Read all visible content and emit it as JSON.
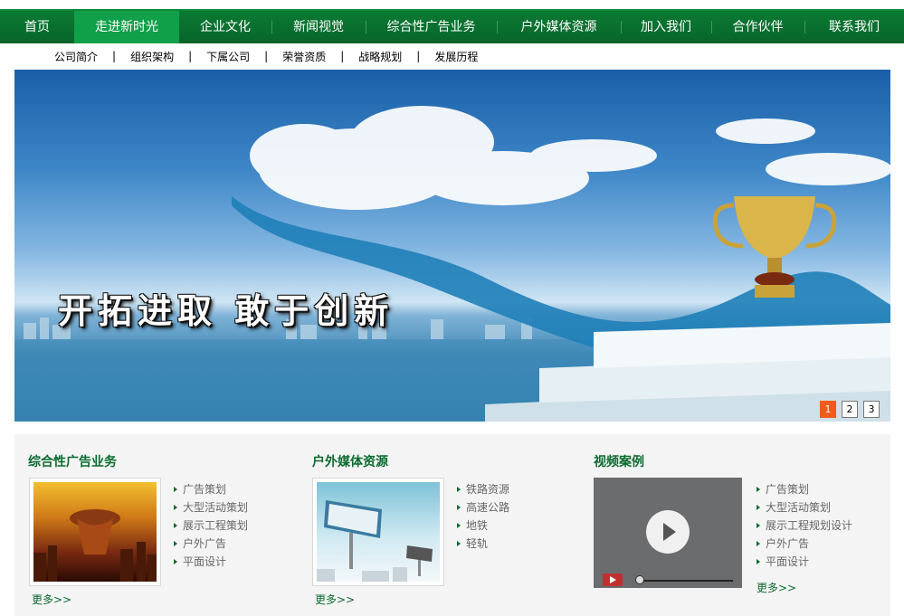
{
  "nav": {
    "items": [
      {
        "label": "首页"
      },
      {
        "label": "走进新时光"
      },
      {
        "label": "企业文化"
      },
      {
        "label": "新闻视觉"
      },
      {
        "label": "综合性广告业务"
      },
      {
        "label": "户外媒体资源"
      },
      {
        "label": "加入我们"
      },
      {
        "label": "合作伙伴"
      },
      {
        "label": "联系我们"
      }
    ],
    "active_index": 1
  },
  "subnav": {
    "items": [
      "公司简介",
      "组织架构",
      "下属公司",
      "荣誉资质",
      "战略规划",
      "发展历程"
    ],
    "separator": "|"
  },
  "banner": {
    "slogan": "开拓进取  敢于创新",
    "pages": [
      "1",
      "2",
      "3"
    ],
    "current_page": "1"
  },
  "sections": {
    "ads": {
      "title": "综合性广告业务",
      "links": [
        "广告策划",
        "大型活动策划",
        "展示工程策划",
        "户外广告",
        "平面设计"
      ],
      "more": "更多>>"
    },
    "outdoor": {
      "title": "户外媒体资源",
      "links": [
        "铁路资源",
        "高速公路",
        "地铁",
        "轻轨"
      ],
      "more": "更多>>"
    },
    "video": {
      "title": "视频案例",
      "links": [
        "广告策划",
        "大型活动策划",
        "展示工程规划设计",
        "户外广告",
        "平面设计"
      ],
      "more": "更多>>"
    }
  },
  "colors": {
    "nav_green": "#07652a",
    "nav_active": "#11a04a",
    "title_green": "#0b6b2f",
    "pager_active": "#f05a1a"
  },
  "icons": {
    "bullet": "triangle-right-icon",
    "play": "play-icon"
  }
}
